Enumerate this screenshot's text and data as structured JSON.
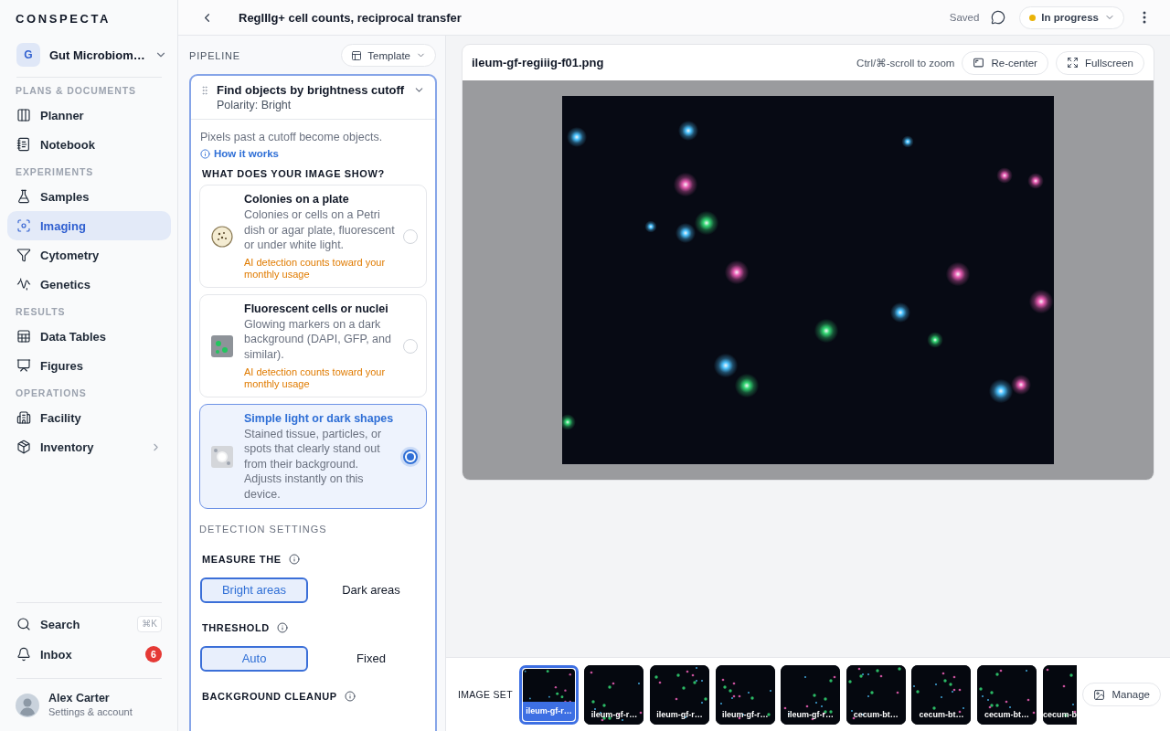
{
  "sidebar": {
    "brand": "CONSPECTA",
    "workspace": {
      "initial": "G",
      "name": "Gut Microbiom…"
    },
    "sections": [
      {
        "title": "PLANS & DOCUMENTS",
        "items": [
          {
            "label": "Planner",
            "selected": false,
            "expandable": false
          },
          {
            "label": "Notebook",
            "selected": false,
            "expandable": false
          }
        ]
      },
      {
        "title": "EXPERIMENTS",
        "items": [
          {
            "label": "Samples",
            "selected": false,
            "expandable": false
          },
          {
            "label": "Imaging",
            "selected": true,
            "expandable": false
          },
          {
            "label": "Cytometry",
            "selected": false,
            "expandable": false
          },
          {
            "label": "Genetics",
            "selected": false,
            "expandable": false
          }
        ]
      },
      {
        "title": "RESULTS",
        "items": [
          {
            "label": "Data Tables",
            "selected": false,
            "expandable": false
          },
          {
            "label": "Figures",
            "selected": false,
            "expandable": false
          }
        ]
      },
      {
        "title": "OPERATIONS",
        "items": [
          {
            "label": "Facility",
            "selected": false,
            "expandable": false
          },
          {
            "label": "Inventory",
            "selected": false,
            "expandable": true
          }
        ]
      }
    ],
    "search": {
      "label": "Search",
      "shortcut": "⌘K"
    },
    "inbox": {
      "label": "Inbox",
      "badge": "6"
    },
    "user": {
      "name": "Alex Carter",
      "subtitle": "Settings & account"
    }
  },
  "header": {
    "title": "RegIIIg+ cell counts, reciprocal transfer",
    "save_status": "Saved",
    "status": "In progress"
  },
  "pipeline": {
    "title": "PIPELINE",
    "template_button": "Template",
    "step": {
      "title": "Find objects by brightness cutoff",
      "subtitle": "Polarity: Bright",
      "expanded": true,
      "description": "Pixels past a cutoff become objects.",
      "help_link": "How it works",
      "question": "WHAT DOES YOUR IMAGE SHOW?",
      "options": [
        {
          "title": "Colonies on a plate",
          "description": "Colonies or cells on a Petri dish or agar plate, fluorescent or under white light.",
          "note": "AI detection counts toward your monthly usage",
          "selected": false
        },
        {
          "title": "Fluorescent cells or nuclei",
          "description": "Glowing markers on a dark background (DAPI, GFP, and similar).",
          "note": "AI detection counts toward your monthly usage",
          "selected": false
        },
        {
          "title": "Simple light or dark shapes",
          "description": "Stained tissue, particles, or spots that clearly stand out from their background. Adjusts instantly on this device.",
          "selected": true
        }
      ],
      "settings_title": "DETECTION SETTINGS",
      "settings": [
        {
          "label": "MEASURE THE",
          "options": [
            {
              "label": "Bright areas",
              "selected": true
            },
            {
              "label": "Dark areas",
              "selected": false
            }
          ]
        },
        {
          "label": "THRESHOLD",
          "options": [
            {
              "label": "Auto",
              "selected": true
            },
            {
              "label": "Fixed",
              "selected": false
            }
          ]
        },
        {
          "label": "BACKGROUND CLEANUP"
        }
      ]
    }
  },
  "viewer": {
    "filename": "ileum-gf-regiiig-f01.png",
    "zoom_hint": "Ctrl/⌘-scroll to zoom",
    "buttons": [
      "Re-center",
      "Fullscreen"
    ]
  },
  "image_set": {
    "title": "IMAGE SET",
    "images": [
      {
        "label": "ileum-gf-r…",
        "selected": true
      },
      {
        "label": "ileum-gf-r…",
        "selected": false
      },
      {
        "label": "ileum-gf-r…",
        "selected": false
      },
      {
        "label": "ileum-gf-r…",
        "selected": false
      },
      {
        "label": "ileum-gf-r…",
        "selected": false
      },
      {
        "label": "cecum-bt…",
        "selected": false
      },
      {
        "label": "cecum-bt…",
        "selected": false
      },
      {
        "label": "cecum-bt…",
        "selected": false
      },
      {
        "label": "cecum-b",
        "selected": false
      }
    ],
    "manage_button": "Manage"
  }
}
